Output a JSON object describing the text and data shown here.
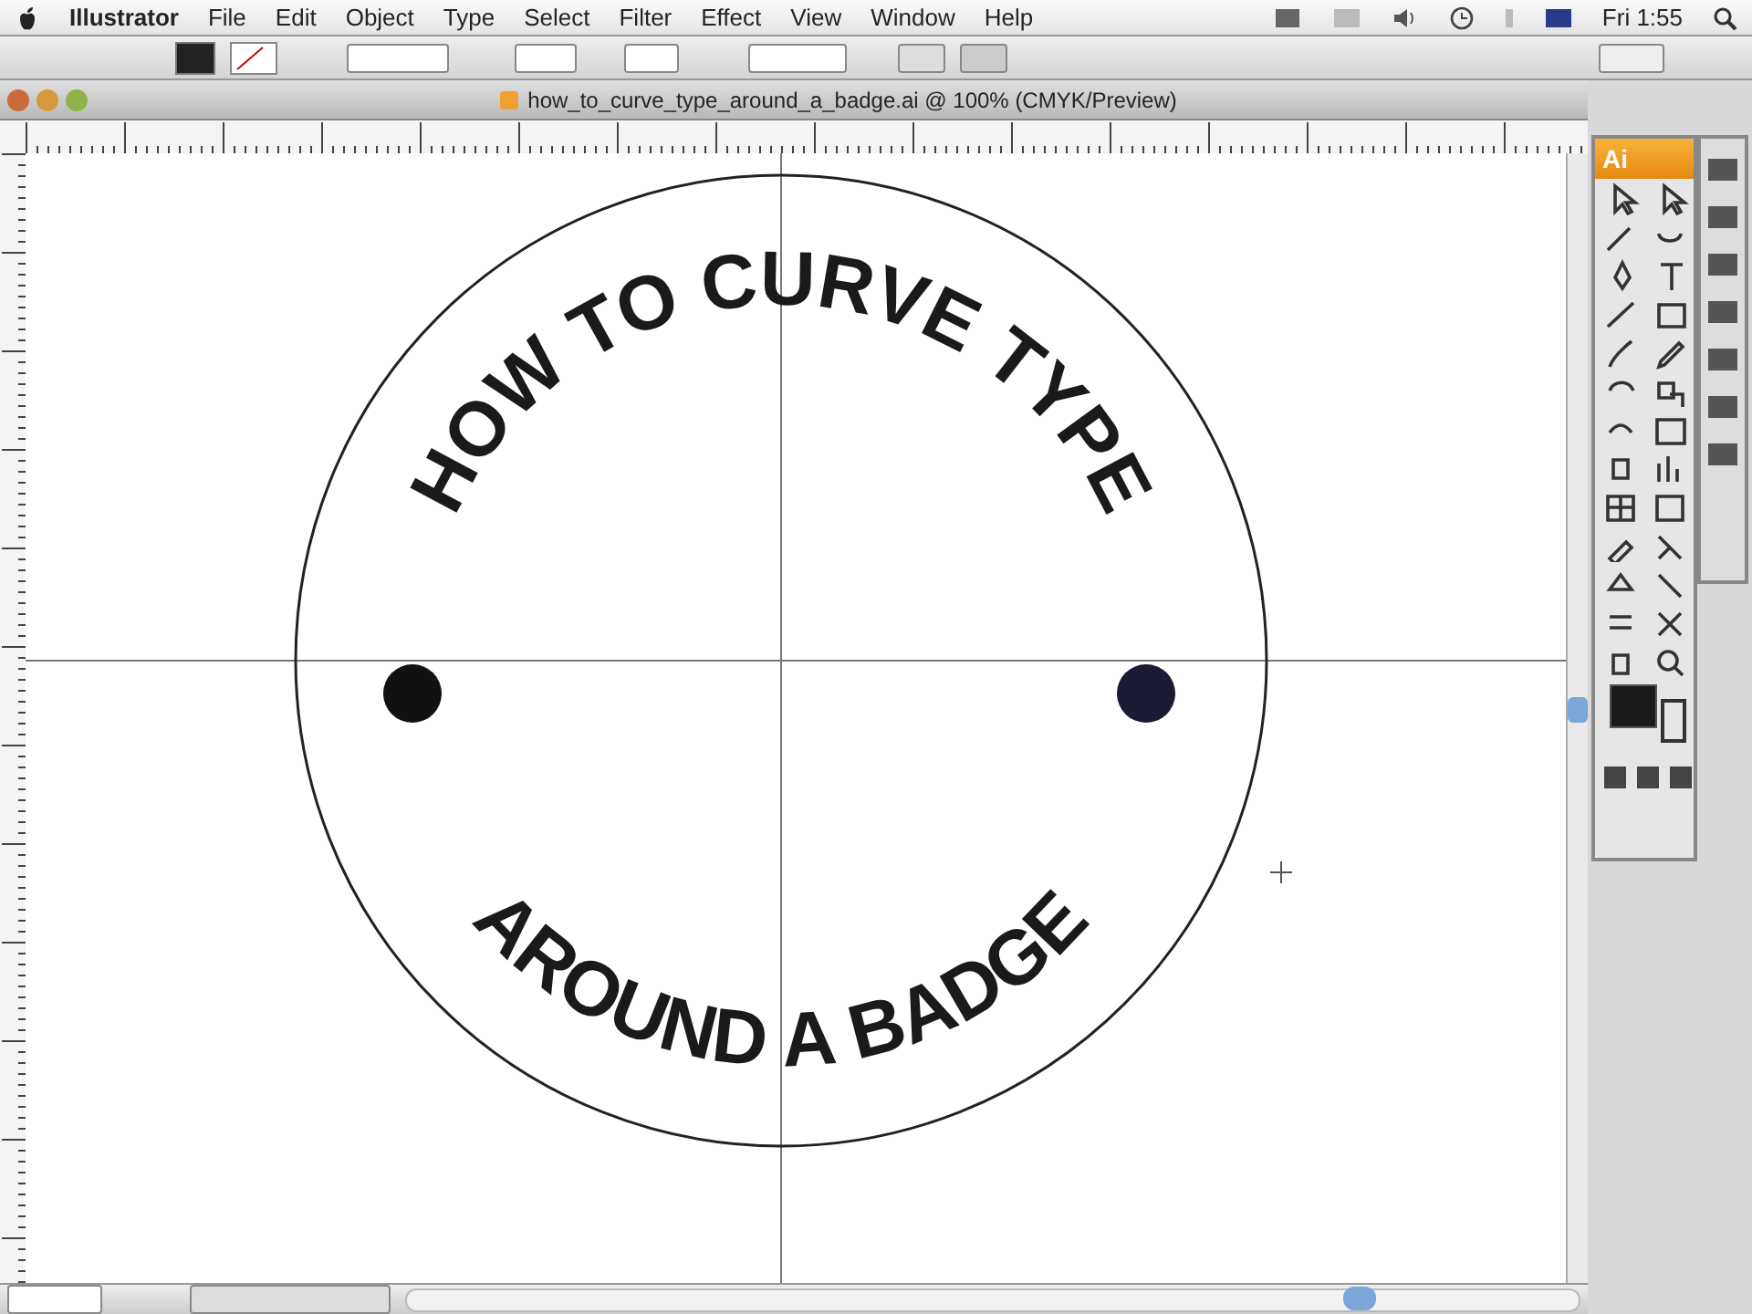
{
  "menubar": {
    "app": "Illustrator",
    "menus": [
      "File",
      "Edit",
      "Object",
      "Type",
      "Select",
      "Filter",
      "Effect",
      "View",
      "Window",
      "Help"
    ],
    "clock": "Fri 1:55"
  },
  "document": {
    "title": "how_to_curve_type_around_a_badge.ai @ 100% (CMYK/Preview)"
  },
  "artwork": {
    "top_text": "HOW TO CURVE TYPE",
    "bottom_text": "AROUND A BADGE"
  },
  "toolbox": {
    "header": "Ai"
  }
}
